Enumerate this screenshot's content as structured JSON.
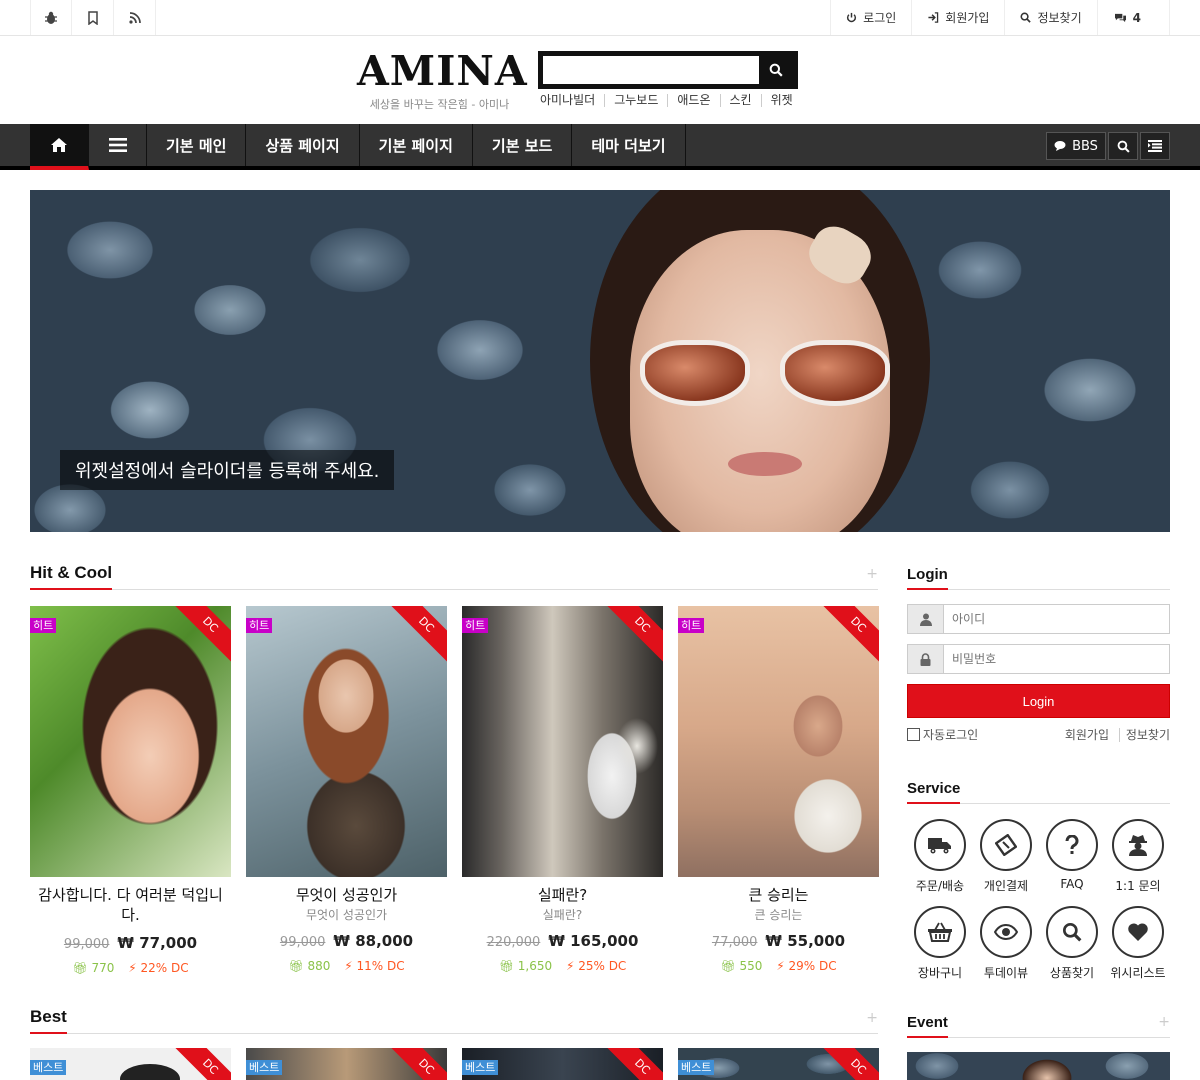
{
  "topbar": {
    "icons": [
      "bug-icon",
      "bookmark-icon",
      "rss-icon"
    ],
    "links": [
      {
        "icon": "power-icon",
        "label": "로그인"
      },
      {
        "icon": "sign-in-icon",
        "label": "회원가입"
      },
      {
        "icon": "search-icon",
        "label": "정보찾기"
      },
      {
        "icon": "comments-icon",
        "label": "4"
      }
    ]
  },
  "header": {
    "logo": "AMINA",
    "tagline": "세상을 바꾸는 작은힘 - 아미나",
    "search_value": "",
    "quick_links": [
      "아미나빌더",
      "그누보드",
      "애드온",
      "스킨",
      "위젯"
    ]
  },
  "nav": {
    "items": [
      "기본 메인",
      "상품 페이지",
      "기본 페이지",
      "기본 보드",
      "테마 더보기"
    ],
    "right": {
      "bbs": "BBS"
    }
  },
  "slider": {
    "caption": "위젯설정에서 슬라이더를 등록해 주세요."
  },
  "hit_cool": {
    "title": "Hit & Cool",
    "more": "+",
    "products": [
      {
        "badge": "히트",
        "ribbon": "DC",
        "name": "감사합니다. 다 여러분 덕입니다.",
        "sub": "",
        "old_price": "99,000",
        "price": "₩ 77,000",
        "hits": "770",
        "dc": "22% DC"
      },
      {
        "badge": "히트",
        "ribbon": "DC",
        "name": "무엇이 성공인가",
        "sub": "무엇이 성공인가",
        "old_price": "99,000",
        "price": "₩ 88,000",
        "hits": "880",
        "dc": "11% DC"
      },
      {
        "badge": "히트",
        "ribbon": "DC",
        "name": "실패란?",
        "sub": "실패란?",
        "old_price": "220,000",
        "price": "₩ 165,000",
        "hits": "1,650",
        "dc": "25% DC"
      },
      {
        "badge": "히트",
        "ribbon": "DC",
        "name": "큰 승리는",
        "sub": "큰 승리는",
        "old_price": "77,000",
        "price": "₩ 55,000",
        "hits": "550",
        "dc": "29% DC"
      }
    ]
  },
  "best": {
    "title": "Best",
    "more": "+",
    "items": [
      {
        "badge": "베스트",
        "ribbon": "DC"
      },
      {
        "badge": "베스트",
        "ribbon": "DC"
      },
      {
        "badge": "베스트",
        "ribbon": "DC"
      },
      {
        "badge": "베스트",
        "ribbon": "DC"
      }
    ]
  },
  "login": {
    "title": "Login",
    "id_placeholder": "아이디",
    "pw_placeholder": "비밀번호",
    "button": "Login",
    "auto_login": "자동로그인",
    "signup": "회원가입",
    "find": "정보찾기"
  },
  "service": {
    "title": "Service",
    "items": [
      {
        "icon": "truck-icon",
        "label": "주문/배송"
      },
      {
        "icon": "ticket-icon",
        "label": "개인결제"
      },
      {
        "icon": "question-icon",
        "label": "FAQ"
      },
      {
        "icon": "user-secret-icon",
        "label": "1:1 문의"
      },
      {
        "icon": "basket-icon",
        "label": "장바구니"
      },
      {
        "icon": "eye-icon",
        "label": "투데이뷰"
      },
      {
        "icon": "search-icon",
        "label": "상품찾기"
      },
      {
        "icon": "heart-icon",
        "label": "위시리스트"
      }
    ]
  },
  "event": {
    "title": "Event",
    "more": "+"
  },
  "colors": {
    "accent": "#e0101a",
    "nav_bg": "#333333",
    "hit_badge": "#c800c8",
    "best_badge": "#3f8fd6"
  }
}
